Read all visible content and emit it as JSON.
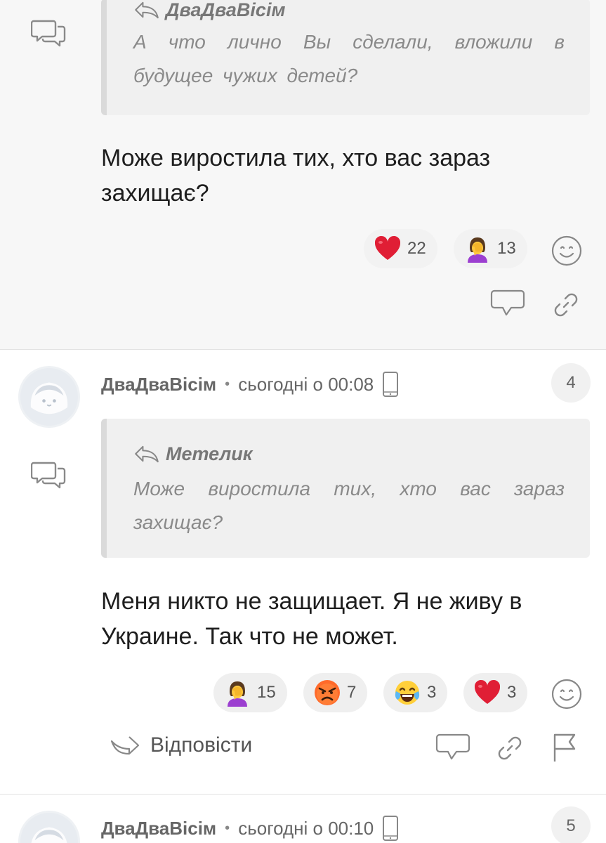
{
  "comments": [
    {
      "quote": {
        "author": "ДваДваВісім",
        "text": "А что лично Вы сделали, вложили в будущее чужих детей?"
      },
      "text": "Може виростила тих, хто вас зараз захищає?",
      "reactions": [
        {
          "emoji": "heart",
          "count": "22"
        },
        {
          "emoji": "facepalm",
          "count": "13"
        }
      ]
    },
    {
      "author": "ДваДваВісім",
      "separator": "•",
      "time": "сьогодні о 00:08",
      "number": "4",
      "quote": {
        "author": "Метелик",
        "text": "Може виростила тих, хто вас зараз захищає?"
      },
      "text": "Меня никто не защищает. Я не живу в Украине. Так что не может.",
      "reactions": [
        {
          "emoji": "facepalm",
          "count": "15"
        },
        {
          "emoji": "angry",
          "count": "7"
        },
        {
          "emoji": "joy",
          "count": "3"
        },
        {
          "emoji": "heart",
          "count": "3"
        }
      ],
      "reply_label": "Відповісти"
    },
    {
      "author": "ДваДваВісім",
      "separator": "•",
      "time": "сьогодні о 00:10",
      "number": "5"
    }
  ]
}
